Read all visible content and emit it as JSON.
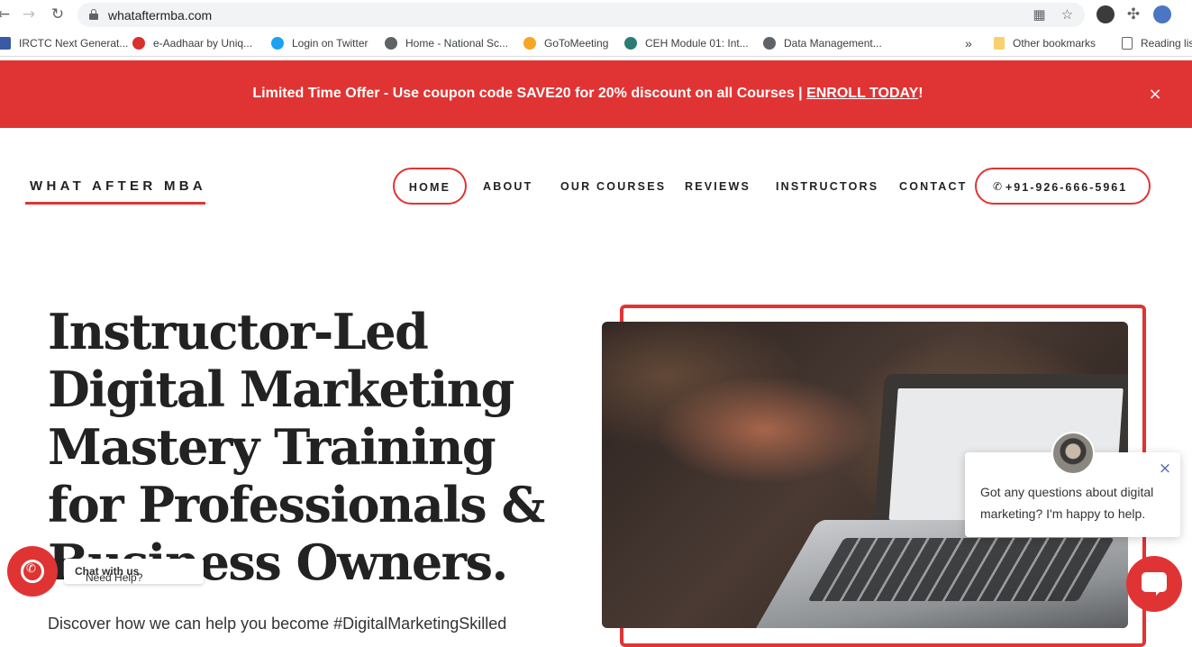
{
  "browser": {
    "url": "whataftermba.com",
    "bookmarks": [
      {
        "label": "IRCTC Next Generat...",
        "color": "#3a5aa8"
      },
      {
        "label": "e-Aadhaar by Uniq...",
        "color": "#d9302c"
      },
      {
        "label": "Login on Twitter",
        "color": "#1da1f2"
      },
      {
        "label": "Home - National Sc...",
        "color": "#5f6368"
      },
      {
        "label": "GoToMeeting",
        "color": "#f5a623"
      },
      {
        "label": "CEH Module 01: Int...",
        "color": "#2a7d74"
      },
      {
        "label": "Data Management...",
        "color": "#5f6368"
      }
    ],
    "more_label": "»",
    "other_bookmarks": "Other bookmarks",
    "reading_list": "Reading list"
  },
  "promo": {
    "text": "Limited Time Offer - Use coupon code SAVE20 for 20% discount on all Courses | ",
    "link": "ENROLL TODAY",
    "suffix": "!",
    "close": "×"
  },
  "header": {
    "logo": "WHAT AFTER MBA",
    "nav": [
      "HOME",
      "ABOUT",
      "OUR COURSES",
      "REVIEWS",
      "INSTRUCTORS",
      "CONTACT"
    ],
    "phone": "+91-926-666-5961"
  },
  "hero": {
    "title": "Instructor-Led Digital Marketing Mastery Training for Professionals & Business Owners.",
    "subtitle": "Discover how we can help you become #DigitalMarketingSkilled"
  },
  "chat": {
    "message": "Got any questions about digital marketing? I'm happy to help.",
    "close": "×"
  },
  "whatsapp": {
    "label_prefix": "Need Help? ",
    "label_bold": "Chat with us"
  },
  "colors": {
    "accent": "#e03434"
  }
}
